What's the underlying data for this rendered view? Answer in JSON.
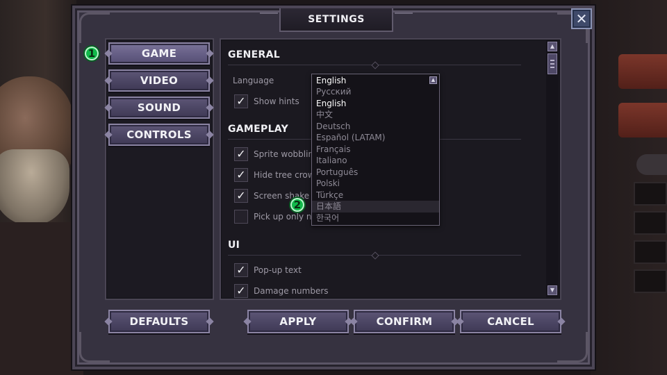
{
  "window": {
    "title": "SETTINGS",
    "close_icon": "close-icon"
  },
  "nav": {
    "items": [
      {
        "label": "GAME",
        "active": true
      },
      {
        "label": "VIDEO",
        "active": false
      },
      {
        "label": "SOUND",
        "active": false
      },
      {
        "label": "CONTROLS",
        "active": false
      }
    ]
  },
  "sections": {
    "general": {
      "title": "GENERAL",
      "language_label": "Language",
      "show_hints": {
        "label": "Show hints",
        "checked": true
      }
    },
    "gameplay": {
      "title": "GAMEPLAY",
      "options": [
        {
          "label": "Sprite wobblin",
          "checked": true
        },
        {
          "label": "Hide tree crow",
          "checked": true
        },
        {
          "label": "Screen shake",
          "checked": true
        },
        {
          "label": "Pick up only ni",
          "checked": false
        }
      ]
    },
    "ui": {
      "title": "UI",
      "options": [
        {
          "label": "Pop-up text",
          "checked": true
        },
        {
          "label": "Damage numbers",
          "checked": true
        }
      ]
    }
  },
  "language_dropdown": {
    "selected": "English",
    "options": [
      "Русский",
      "English",
      "中文",
      "Deutsch",
      "Español (LATAM)",
      "Français",
      "Italiano",
      "Português",
      "Polski",
      "Türkçe",
      "日本語",
      "한국어"
    ],
    "current_option": "English",
    "hovered_option": "日本語"
  },
  "footer": {
    "defaults": "DEFAULTS",
    "apply": "APPLY",
    "confirm": "CONFIRM",
    "cancel": "CANCEL"
  },
  "markers": {
    "one": "1",
    "two": "2"
  },
  "colors": {
    "button_face": "#4b4563",
    "button_border": "#8b84a3",
    "panel_bg": "#1b1920",
    "marker_green": "#11b84a"
  }
}
